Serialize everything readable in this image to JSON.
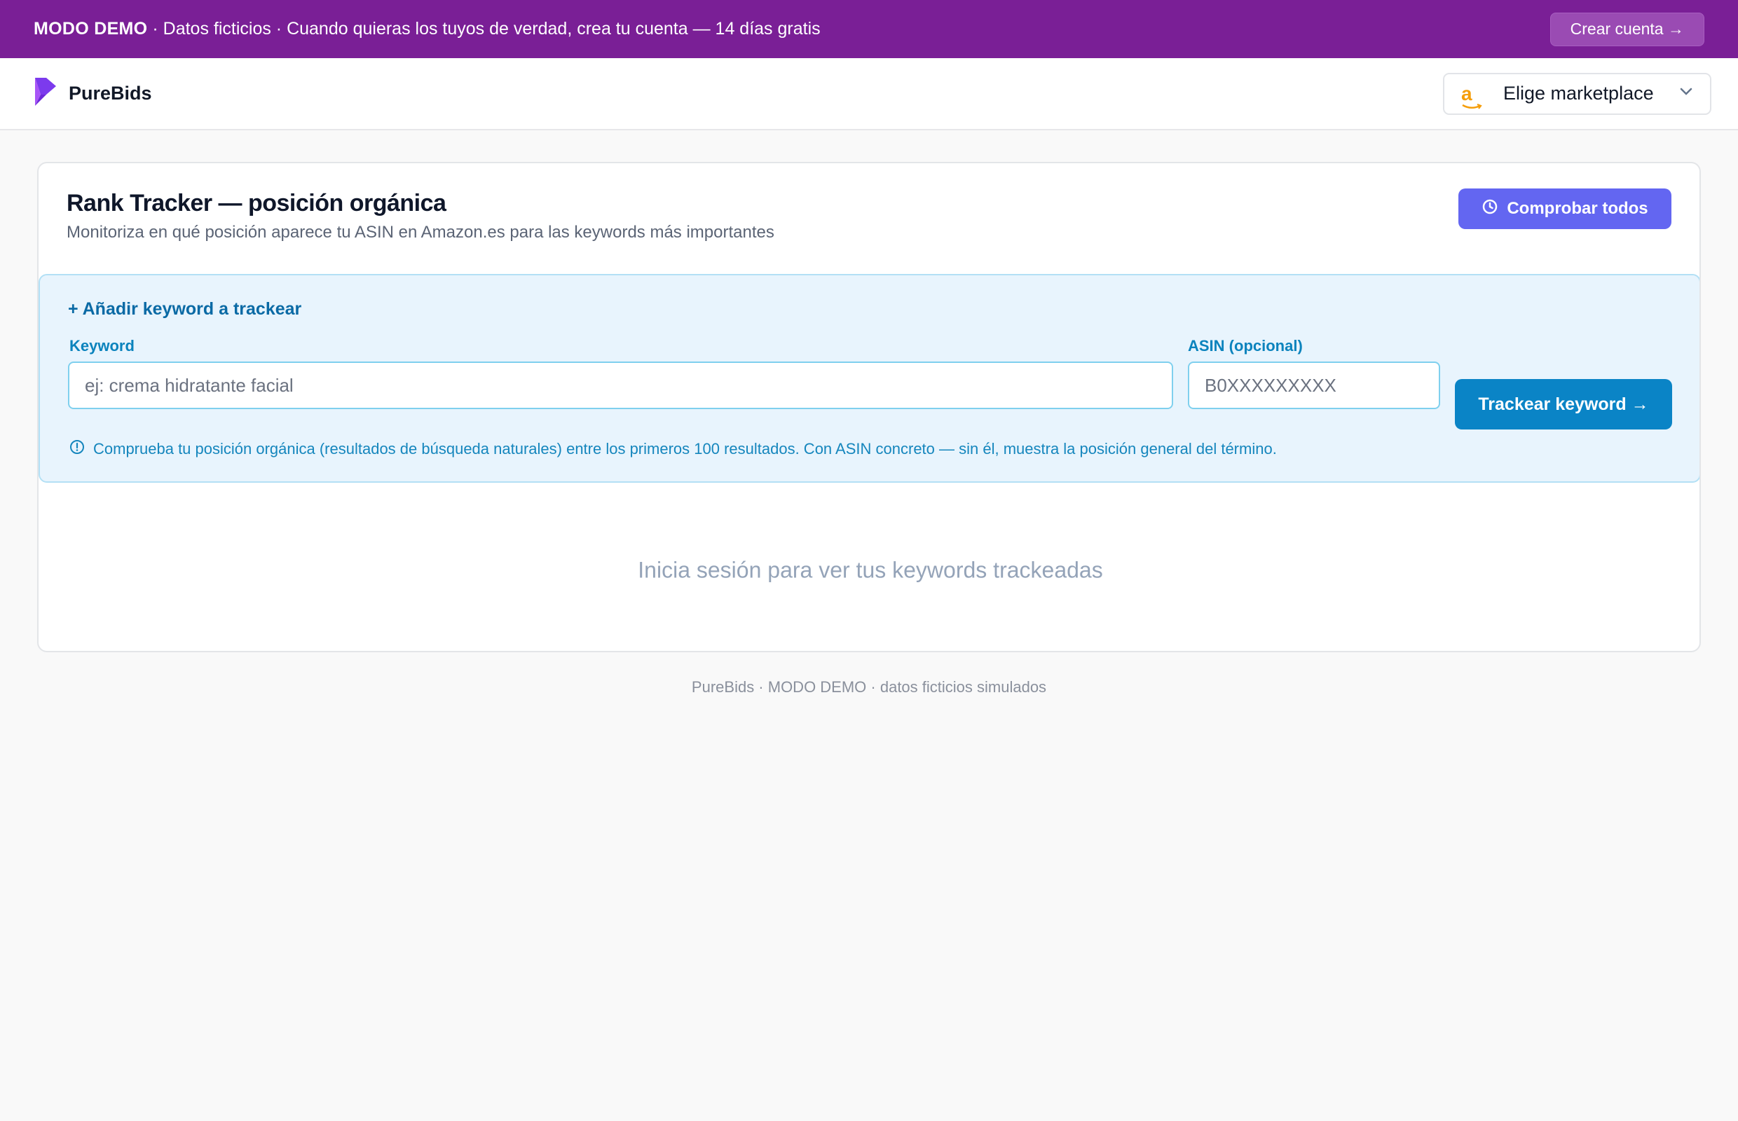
{
  "banner": {
    "mode": "MODO DEMO",
    "message": " · Datos ficticios · Cuando quieras los tuyos de verdad, crea tu cuenta — 14 días gratis",
    "cta_label": "Crear cuenta →"
  },
  "topbar": {
    "brand_name": "PureBids",
    "logo_icon": "purebids-logo-icon",
    "marketplace_logo": "a",
    "marketplace_label": "Elige marketplace",
    "chevron_icon": "chevron-down-icon"
  },
  "card": {
    "title": "Rank Tracker — posición orgánica",
    "subtitle": "Monitoriza en qué posición aparece tu ASIN en Amazon.es para las keywords más importantes",
    "check_all_label": "Comprobar todos",
    "check_all_icon": "clock-icon"
  },
  "add_panel": {
    "title": "+ Añadir keyword a trackear",
    "keyword_label": "Keyword",
    "keyword_placeholder": "ej: crema hidratante facial",
    "keyword_value": "",
    "asin_label": "ASIN (opcional)",
    "asin_placeholder": "B0XXXXXXXXX",
    "asin_value": "",
    "submit_label": "Trackear keyword →",
    "info_icon": "info-icon",
    "info_text": "Comprueba tu posición orgánica (resultados de búsqueda naturales) entre los primeros 100 resultados. Con ASIN concreto — sin él, muestra la posición general del término."
  },
  "empty_state": "Inicia sesión para ver tus keywords trackeadas",
  "footer": "PureBids · MODO DEMO · datos ficticios simulados",
  "colors": {
    "banner_bg": "#7a1f96",
    "accent_indigo": "#6366f1",
    "accent_blue": "#0a84c6",
    "panel_bg": "#e8f4fd",
    "amazon_orange": "#f59e0b"
  }
}
